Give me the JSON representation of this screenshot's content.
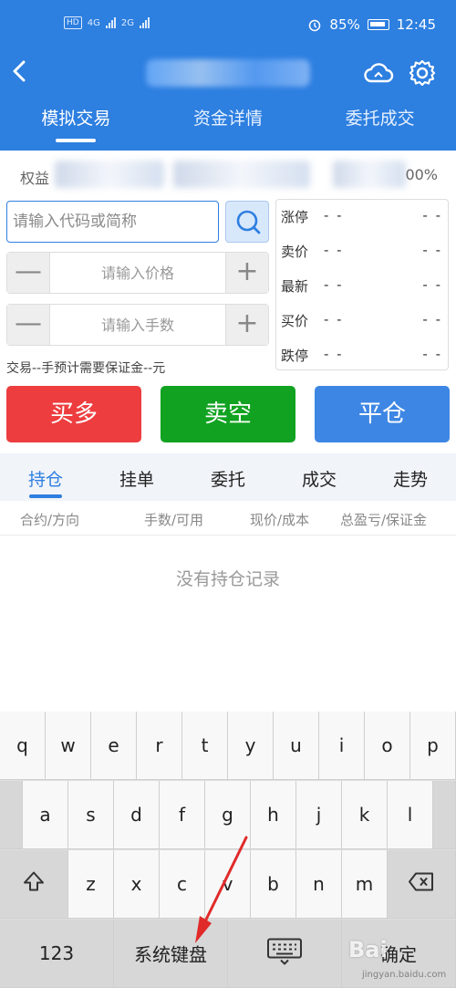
{
  "status_bar": {
    "network": "HD",
    "net1": "4G",
    "net2": "2G",
    "battery": "85%",
    "time": "12:45"
  },
  "nav": {
    "back": "‹"
  },
  "top_tabs": [
    {
      "label": "模拟交易",
      "active": true
    },
    {
      "label": "资金详情",
      "active": false
    },
    {
      "label": "委托成交",
      "active": false
    }
  ],
  "account": {
    "label": "权益",
    "pct": "00%"
  },
  "order": {
    "code_placeholder": "请输入代码或简称",
    "price_placeholder": "请输入价格",
    "qty_placeholder": "请输入手数",
    "minus": "—",
    "plus": "+",
    "margin_note": "交易--手预计需要保证金--元"
  },
  "quote": [
    {
      "label": "涨停",
      "price": "- -",
      "vol": "- -"
    },
    {
      "label": "卖价",
      "price": "- -",
      "vol": "- -"
    },
    {
      "label": "最新",
      "price": "- -",
      "vol": "- -"
    },
    {
      "label": "买价",
      "price": "- -",
      "vol": "- -"
    },
    {
      "label": "跌停",
      "price": "- -",
      "vol": "- -"
    }
  ],
  "actions": {
    "buy": "买多",
    "sell": "卖空",
    "close": "平仓"
  },
  "position_tabs": [
    {
      "label": "持仓",
      "active": true
    },
    {
      "label": "挂单",
      "active": false
    },
    {
      "label": "委托",
      "active": false
    },
    {
      "label": "成交",
      "active": false
    },
    {
      "label": "走势",
      "active": false
    }
  ],
  "columns": [
    "合约/方向",
    "手数/可用",
    "现价/成本",
    "总盈亏/保证金"
  ],
  "empty_message": "没有持仓记录",
  "keyboard": {
    "row1": [
      "q",
      "w",
      "e",
      "r",
      "t",
      "y",
      "u",
      "i",
      "o",
      "p"
    ],
    "row2": [
      "a",
      "s",
      "d",
      "f",
      "g",
      "h",
      "j",
      "k",
      "l"
    ],
    "row3": [
      "z",
      "x",
      "c",
      "v",
      "b",
      "n",
      "m"
    ],
    "num_key": "123",
    "system_keyboard": "系统键盘",
    "confirm": "确定"
  },
  "watermark": {
    "logo": "Bai",
    "url": "jingyan.baidu.com"
  },
  "colors": {
    "primary": "#2d7fe0",
    "buy": "#ed3d3f",
    "sell": "#11a221",
    "close": "#3d86e4"
  },
  "icons": [
    "back-arrow-icon",
    "cloud-sync-icon",
    "gear-icon",
    "search-icon",
    "shift-icon",
    "backspace-icon",
    "keyboard-hide-icon"
  ]
}
